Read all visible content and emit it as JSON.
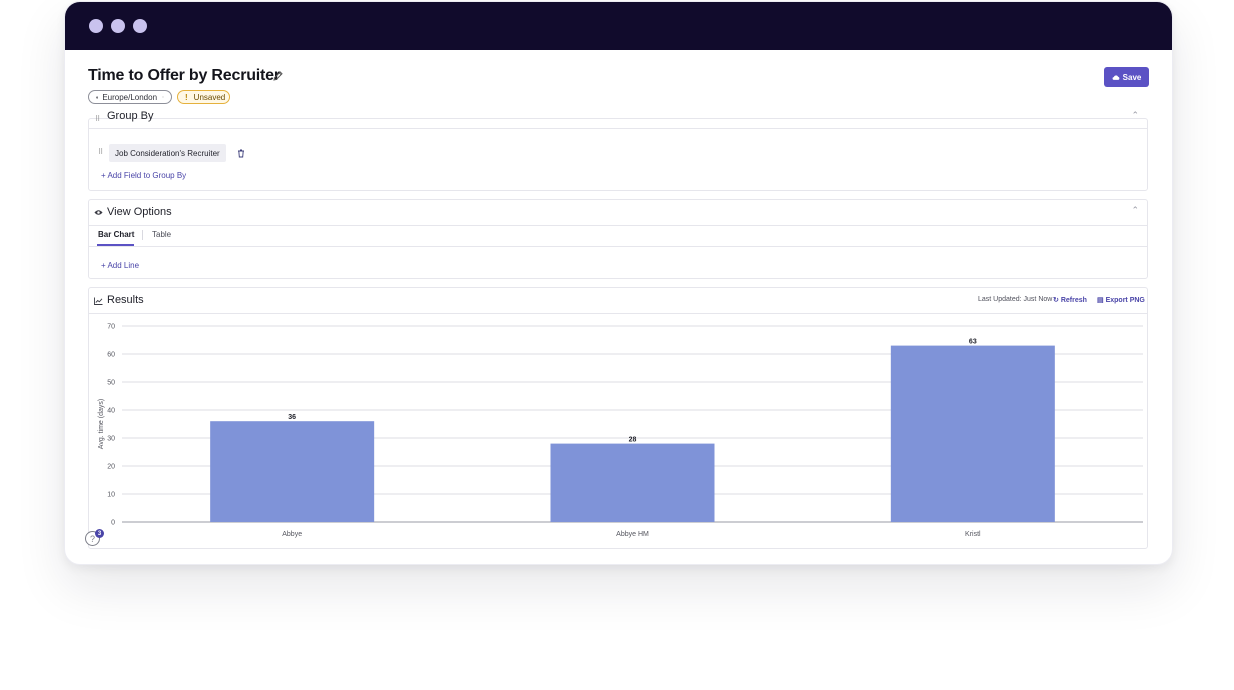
{
  "header": {
    "title": "Time to Offer by Recruiter",
    "timezone": "Europe/London",
    "status": "Unsaved",
    "save_label": "Save"
  },
  "group_by": {
    "title": "Group By",
    "field": "Job Consideration's Recruiter",
    "add_field_label": "+ Add Field to Group By"
  },
  "view_options": {
    "title": "View Options",
    "tabs": [
      {
        "label": "Bar Chart",
        "active": true
      },
      {
        "label": "Table",
        "active": false
      }
    ],
    "add_line_label": "+ Add Line"
  },
  "results": {
    "title": "Results",
    "last_updated": "Last Updated: Just Now",
    "refresh_label": "Refresh",
    "export_label": "Export PNG"
  },
  "help": {
    "symbol": "?",
    "badge_count": "3"
  },
  "colors": {
    "accent": "#5b52c4",
    "bar": "#7f93d8",
    "titlebar": "#110b2c"
  },
  "chart_data": {
    "type": "bar",
    "categories": [
      "Abbye",
      "Abbye HM",
      "Kristl"
    ],
    "values": [
      36,
      28,
      63
    ],
    "data_labels": [
      "36",
      "28",
      "63"
    ],
    "title": "",
    "xlabel": "",
    "ylabel": "Avg. time (days)",
    "ylim": [
      0,
      70
    ],
    "yticks": [
      0,
      10,
      20,
      30,
      40,
      50,
      60,
      70
    ],
    "grid": true,
    "legend": "none"
  }
}
